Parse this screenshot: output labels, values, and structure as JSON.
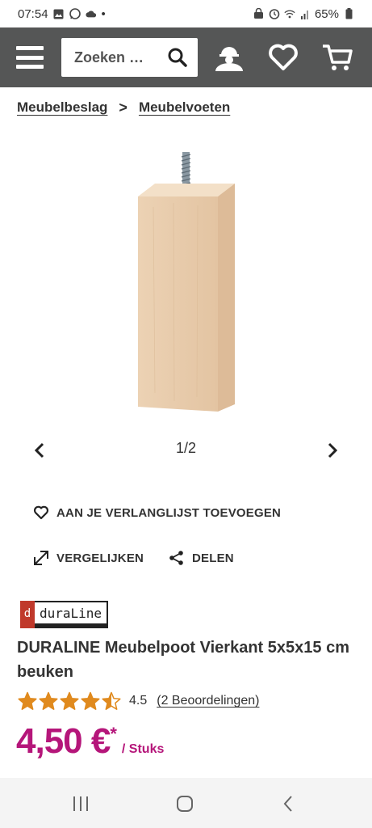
{
  "status_bar": {
    "time": "07:54",
    "dot": "•",
    "battery": "65%"
  },
  "nav": {
    "search_placeholder": "Zoeken …",
    "icons": [
      "menu-icon",
      "search-icon",
      "account-icon",
      "wishlist-heart-icon",
      "cart-icon"
    ]
  },
  "breadcrumb": {
    "items": [
      "Meubelbeslag",
      "Meubelvoeten"
    ],
    "separator": ">"
  },
  "gallery": {
    "counter": "1/2"
  },
  "actions": {
    "wishlist": "AAN JE VERLANGLIJST TOEVOEGEN",
    "compare": "VERGELIJKEN",
    "share": "DELEN"
  },
  "brand": {
    "mark": "d",
    "name": "duraLine"
  },
  "product": {
    "title": "DURALINE Meubelpoot Vierkant 5x5x15 cm beuken",
    "rating_value": "4.5",
    "rating_stars": 4.5,
    "reviews": "(2 Beoordelingen)",
    "price": "4,50 €",
    "price_mark": "*",
    "unit": "/ Stuks"
  },
  "colors": {
    "nav_bg": "#555656",
    "price": "#b5167a",
    "star": "#e08a1e"
  }
}
